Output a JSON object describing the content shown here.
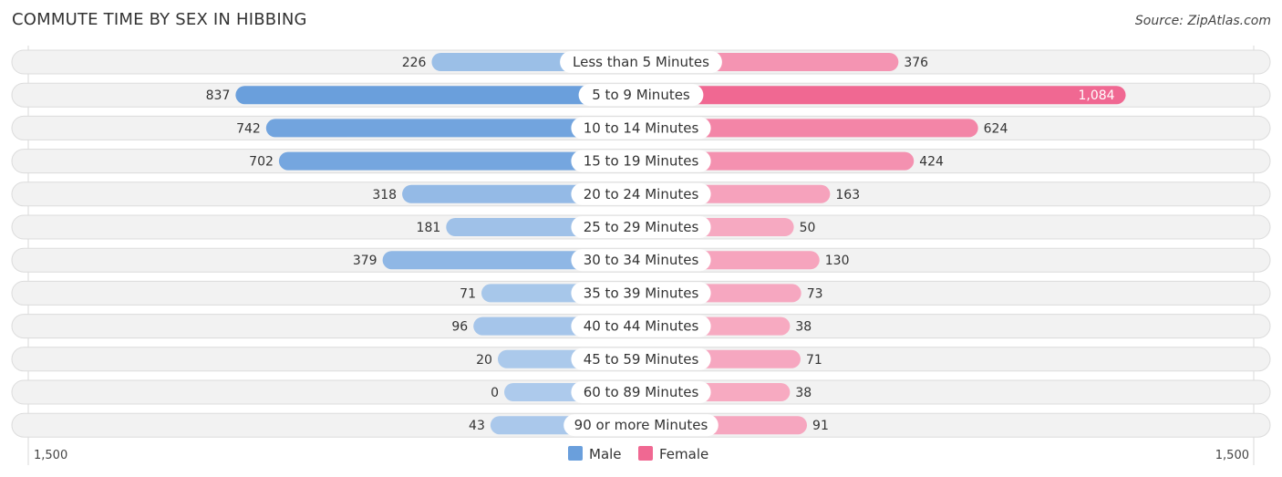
{
  "title": "COMMUTE TIME BY SEX IN HIBBING",
  "source": "Source: ZipAtlas.com",
  "chart_data": {
    "type": "bar",
    "orientation": "horizontal-diverging",
    "title": "COMMUTE TIME BY SEX IN HIBBING",
    "categories": [
      "Less than 5 Minutes",
      "5 to 9 Minutes",
      "10 to 14 Minutes",
      "15 to 19 Minutes",
      "20 to 24 Minutes",
      "25 to 29 Minutes",
      "30 to 34 Minutes",
      "35 to 39 Minutes",
      "40 to 44 Minutes",
      "45 to 59 Minutes",
      "60 to 89 Minutes",
      "90 or more Minutes"
    ],
    "series": [
      {
        "name": "Male",
        "color": "#6a9fdc",
        "side": "left",
        "values": [
          226,
          837,
          742,
          702,
          318,
          181,
          379,
          71,
          96,
          20,
          0,
          43
        ],
        "labels": [
          "226",
          "837",
          "742",
          "702",
          "318",
          "181",
          "379",
          "71",
          "96",
          "20",
          "0",
          "43"
        ]
      },
      {
        "name": "Female",
        "color": "#f06892",
        "side": "right",
        "values": [
          376,
          1084,
          624,
          424,
          163,
          50,
          130,
          73,
          38,
          71,
          38,
          91
        ],
        "labels": [
          "376",
          "1,084",
          "624",
          "424",
          "163",
          "50",
          "130",
          "73",
          "38",
          "71",
          "38",
          "91"
        ]
      }
    ],
    "axis": {
      "left_label": "1,500",
      "right_label": "1,500",
      "range": [
        1500,
        1500
      ]
    },
    "legend": {
      "position": "bottom-center",
      "items": [
        "Male",
        "Female"
      ]
    }
  }
}
